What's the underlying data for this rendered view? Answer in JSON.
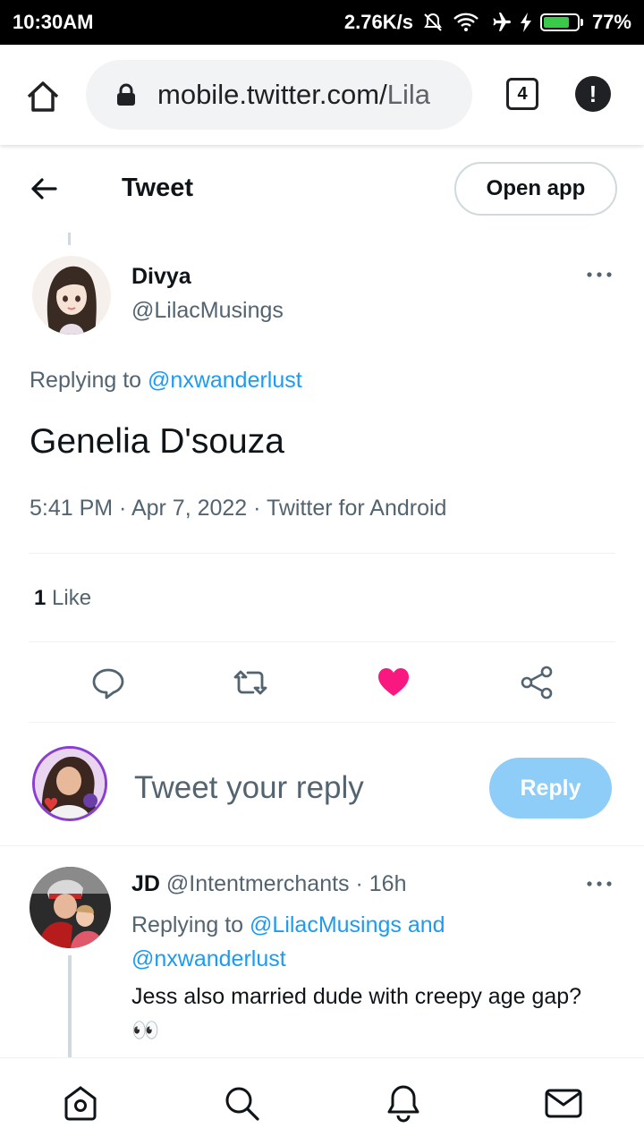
{
  "status_bar": {
    "time": "10:30AM",
    "network_speed": "2.76K/s",
    "battery_percent": "77%",
    "battery_level": 0.77,
    "icons": [
      "mute-icon",
      "wifi-icon",
      "airplane-icon",
      "charging-icon",
      "battery-icon"
    ]
  },
  "browser": {
    "url_main": "mobile.twitter.com/",
    "url_rest": "Lila",
    "tab_count": "4",
    "alert_symbol": "!"
  },
  "header": {
    "title": "Tweet",
    "open_app_label": "Open app"
  },
  "tweet": {
    "author_name": "Divya",
    "author_handle": "@LilacMusings",
    "replying_prefix": "Replying to ",
    "replying_to": "@nxwanderlust",
    "text": "Genelia D'souza",
    "meta": "5:41 PM · Apr 7, 2022 · Twitter for Android",
    "like_count": "1",
    "like_label": " Like",
    "liked": true
  },
  "composer": {
    "placeholder": "Tweet your reply",
    "reply_button": "Reply"
  },
  "reply": {
    "name": "JD",
    "handle": "@Intentmerchants",
    "separator": " · ",
    "time": "16h",
    "replying_prefix": "Replying to ",
    "replying_to_line1": "@LilacMusings and",
    "replying_to_line2": "@nxwanderlust",
    "text": "Jess also married dude with creepy age gap? 👀"
  },
  "colors": {
    "accent": "#1d9bf0",
    "like": "#f91880",
    "reply_button_disabled": "#8ecdf8",
    "secondary_text": "#536471"
  }
}
